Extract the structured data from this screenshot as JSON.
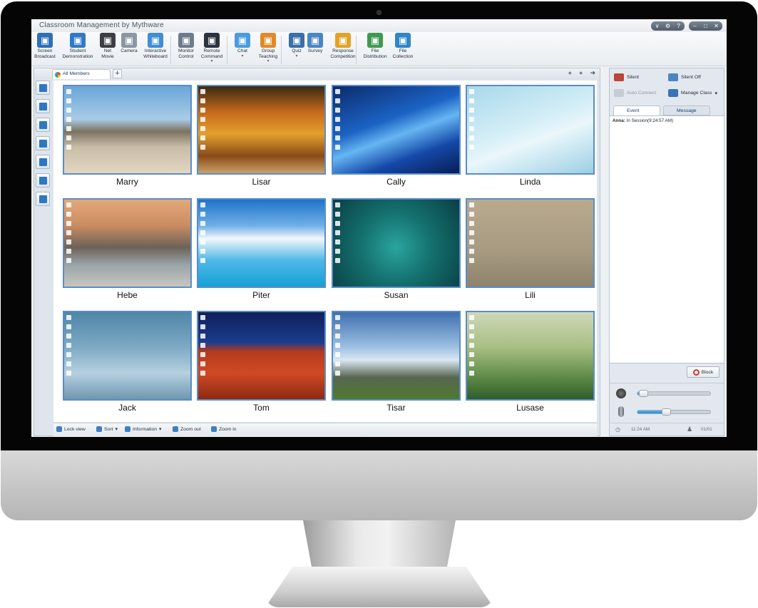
{
  "app": {
    "title": "Classroom Management by Mythware"
  },
  "window_buttons": [
    "∨",
    "⚙",
    "?",
    "–",
    "□",
    "✕"
  ],
  "toolbar": [
    {
      "label": "Screen\nBroadcast",
      "icon": "screen-broadcast-icon",
      "color": "#2e6fb8"
    },
    {
      "label": "Student\nDemonstration",
      "icon": "student-demonstration-icon",
      "color": "#2f7ac8"
    },
    {
      "label": "Net\nMovie",
      "icon": "film-reel-icon",
      "color": "#3b3f45"
    },
    {
      "label": "Camera",
      "icon": "webcam-icon",
      "color": "#8a96a3"
    },
    {
      "label": "Interactive\nWhiteboard",
      "icon": "whiteboard-icon",
      "color": "#3f8ed6"
    },
    {
      "label": "Monitor\nControl",
      "icon": "monitor-control-icon",
      "color": "#6d7c8c"
    },
    {
      "label": "Remote\nCommand",
      "icon": "remote-command-icon",
      "color": "#2b3440"
    },
    {
      "label": "Chat",
      "icon": "chat-bubble-icon",
      "color": "#4a9be0"
    },
    {
      "label": "Group\nTeaching",
      "icon": "group-teaching-icon",
      "color": "#e08a2a"
    },
    {
      "label": "Quiz",
      "icon": "quiz-clock-icon",
      "color": "#3a6fa8"
    },
    {
      "label": "Survey",
      "icon": "survey-bars-icon",
      "color": "#4a86c4"
    },
    {
      "label": "Response\nCompetition",
      "icon": "response-competition-icon",
      "color": "#e0a32a"
    },
    {
      "label": "File\nDistribution",
      "icon": "file-distribution-icon",
      "color": "#3f9a4f"
    },
    {
      "label": "File\nCollection",
      "icon": "file-collection-icon",
      "color": "#2f86c9"
    }
  ],
  "tabs": {
    "active": "All Members",
    "add": "+"
  },
  "students": [
    {
      "name": "Marry",
      "wallpaper": "beach",
      "bg": "linear-gradient(180deg,#6aa6d9 0%,#a9cbe6 38%,#7c7260 52%,#c8bda8 70%,#e3d7c2 100%)"
    },
    {
      "name": "Lisar",
      "wallpaper": "autumn-forest",
      "bg": "linear-gradient(180deg,#3a2a12 0%,#c66a1c 30%,#e3a02c 55%,#8a4a18 80%,#c9a26a 100%)"
    },
    {
      "name": "Cally",
      "wallpaper": "blue-abstract",
      "bg": "linear-gradient(160deg,#0c2a6b 0%,#1b63c4 40%,#66b6f2 55%,#1448a8 75%,#081d55 100%)"
    },
    {
      "name": "Linda",
      "wallpaper": "light-cyan",
      "bg": "linear-gradient(160deg,#a8d8ea 0%,#d4eef7 45%,#eaf7fb 60%,#9ccfe3 100%)"
    },
    {
      "name": "Hebe",
      "wallpaper": "misty-mountains",
      "bg": "linear-gradient(180deg,#e3a97a 0%,#c98c62 30%,#6c6258 55%,#9aa4a8 75%,#c7c6be 100%)"
    },
    {
      "name": "Piter",
      "wallpaper": "tropical-sky",
      "bg": "linear-gradient(180deg,#1f73c9 0%,#6fb0e6 30%,#f2f7fb 45%,#4fb8e8 70%,#16a0d6 100%)"
    },
    {
      "name": "Susan",
      "wallpaper": "adyson-logo",
      "bg": "radial-gradient(circle at 50% 55%,#2ba49e 0%,#14706e 45%,#0a3f44 100%)"
    },
    {
      "name": "Lili",
      "wallpaper": "spinning-top",
      "bg": "linear-gradient(180deg,#b9aa8f 0%,#a79a81 60%,#8f826c 100%)"
    },
    {
      "name": "Jack",
      "wallpaper": "moon-sky",
      "bg": "linear-gradient(180deg,#4f86a7 0%,#7da9c4 40%,#b6d0df 70%,#6f97b0 100%)"
    },
    {
      "name": "Tom",
      "wallpaper": "red-dunes",
      "bg": "linear-gradient(180deg,#0f1f5a 0%,#1c3d8c 35%,#b43a1e 45%,#d04a24 70%,#8c2a12 100%)"
    },
    {
      "name": "Tisar",
      "wallpaper": "stonehenge",
      "bg": "linear-gradient(180deg,#3f6fb0 0%,#9cc0e2 40%,#d9e7f2 55%,#586650 75%,#4f7a2f 100%)"
    },
    {
      "name": "Lusase",
      "wallpaper": "green-dandelions",
      "bg": "linear-gradient(180deg,#cfd8b9 0%,#a9bf84 40%,#5e8a46 75%,#2f5c2b 100%)"
    }
  ],
  "statusbar": [
    "Lock view",
    "Sort",
    "Information",
    "Zoom out",
    "Zoom in"
  ],
  "right": {
    "silent": "Silent",
    "silent_off": "Silent Off",
    "auto_connect": "Auto Connect",
    "manage_class": "Manage Class",
    "tab_event": "Event",
    "tab_message": "Message",
    "log_who": "Anna:",
    "log_text": "In Session(9:24:57 AM)",
    "block": "Block",
    "time": "11:24 AM",
    "count": "01/01",
    "speaker_level": 0.08,
    "mic_level": 0.38
  }
}
